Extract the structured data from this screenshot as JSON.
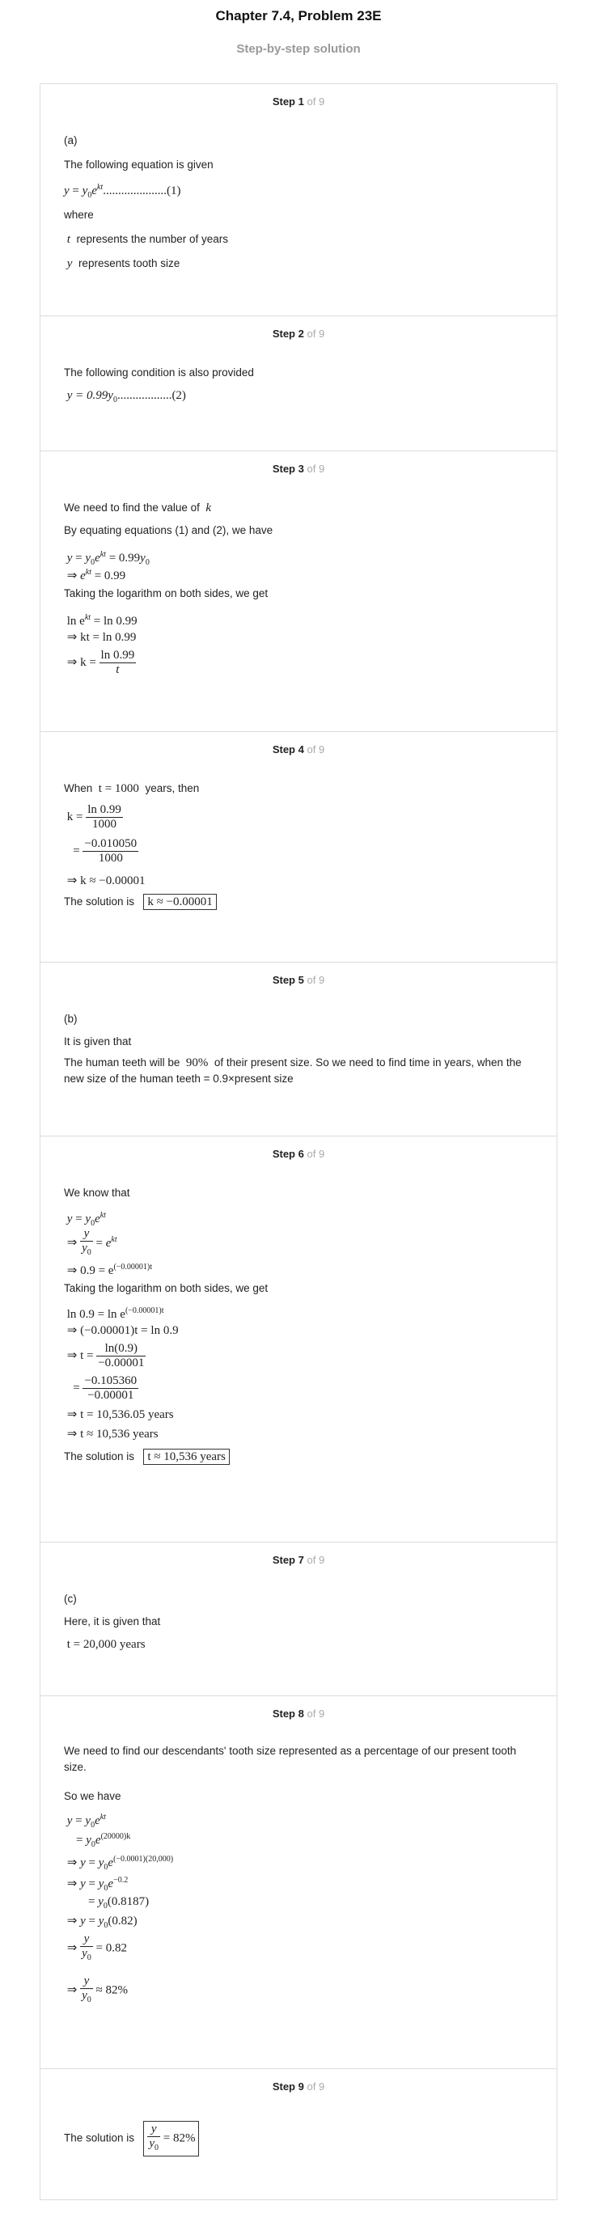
{
  "header": {
    "title": "Chapter 7.4, Problem 23E",
    "subtitle": "Step-by-step solution"
  },
  "step_word": "Step",
  "of_word": "of 9",
  "steps": [
    {
      "num": "1",
      "part": "(a)",
      "text1": "The following equation is given",
      "eq1": ".....................(1)",
      "where": "where",
      "t_desc": "represents the number of years",
      "y_desc": "represents tooth size"
    },
    {
      "num": "2",
      "text1": "The following condition is also provided",
      "eq1": "y = 0.99y",
      "eq1_tail": "..................(2)"
    },
    {
      "num": "3",
      "text1": "We need to find the value of",
      "text2": "By equating equations (1) and (2), we have",
      "text3": "Taking the logarithm on both sides, we get",
      "eq1": "= 0.99",
      "eq3_a": "ln e",
      "eq3_b": "= ln 0.99",
      "eq4": "⇒ kt = ln 0.99",
      "eq5_pre": "⇒ k =",
      "eq5_num": "ln 0.99",
      "eq5_den": "t"
    },
    {
      "num": "4",
      "text_when": "When",
      "t_val": "t = 1000",
      "text_years": "years, then",
      "f1_pre": "k =",
      "f1_num": "ln 0.99",
      "f1_den": "1000",
      "f2_pre": "=",
      "f2_num": "−0.010050",
      "f2_den": "1000",
      "approx": "⇒ k ≈ −0.00001",
      "sol_text": "The solution is",
      "sol_box": "k ≈ −0.00001"
    },
    {
      "num": "5",
      "part": "(b)",
      "text1": "It is given that",
      "text2_a": "The human teeth will be",
      "text2_pct": "90%",
      "text2_b": "of their present size. So we need to find time in years, when the new size of the human teeth = 0.9×present size"
    },
    {
      "num": "6",
      "text1": "We know that",
      "text2": "Taking the logarithm on both sides, we get",
      "arrow": "⇒",
      "l4a": "⇒ 0.9 = e",
      "l4exp": "(−0.00001)t",
      "l5a": "ln 0.9 = ln e",
      "l6": "⇒ (−0.00001)t = ln 0.9",
      "l7_pre": "⇒ t =",
      "l7_num": "ln(0.9)",
      "l7_den": "−0.00001",
      "l8_pre": "=",
      "l8_num": "−0.105360",
      "l8_den": "−0.00001",
      "l9": "⇒ t = 10,536.05 years",
      "l10": "⇒ t ≈ 10,536 years",
      "sol_text": "The solution is",
      "sol_box": "t ≈ 10,536 years"
    },
    {
      "num": "7",
      "part": "(c)",
      "text1": "Here, it is given that",
      "eq1": "t = 20,000 years"
    },
    {
      "num": "8",
      "text1": "We need to find our descendants' tooth size represented as a percentage of our present tooth size.",
      "text2": "So we have",
      "l2exp": "(20000)k",
      "l3exp": "(−0.0001)(20,000)",
      "l4exp": "−0.2",
      "l5": "(0.8187)",
      "l6": "(0.82)",
      "l7_val": "= 0.82",
      "l8_val": "≈ 82%"
    },
    {
      "num": "9",
      "sol_text": "The solution is",
      "sol_val": "= 82%"
    }
  ]
}
